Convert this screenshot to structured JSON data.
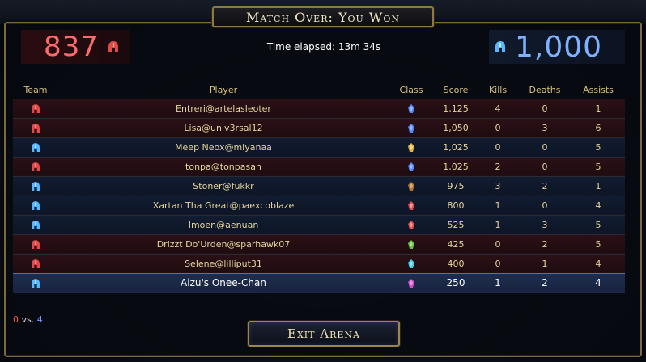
{
  "header": {
    "title": "Match Over: You Won"
  },
  "scores": {
    "red": {
      "value": "837",
      "color": "#ff6b6b"
    },
    "blue": {
      "value": "1,000",
      "color": "#7fb1ff"
    },
    "time_elapsed": "Time elapsed: 13m 34s"
  },
  "table": {
    "columns": [
      "Team",
      "Player",
      "Class",
      "Score",
      "Kills",
      "Deaths",
      "Assists"
    ],
    "rows": [
      {
        "team": "red",
        "player": "Entreri@artelasleoter",
        "class_icon": "blue-wizard-icon",
        "score": "1,125",
        "kills": "4",
        "deaths": "0",
        "assists": "1"
      },
      {
        "team": "red",
        "player": "Lisa@univ3rsal12",
        "class_icon": "blue-wizard-icon",
        "score": "1,050",
        "kills": "0",
        "deaths": "3",
        "assists": "6"
      },
      {
        "team": "blue",
        "player": "Meep Neox@miyanaa",
        "class_icon": "gold-shield-icon",
        "score": "1,025",
        "kills": "0",
        "deaths": "0",
        "assists": "5"
      },
      {
        "team": "red",
        "player": "tonpa@tonpasan",
        "class_icon": "blue-wizard-icon",
        "score": "1,025",
        "kills": "2",
        "deaths": "0",
        "assists": "5"
      },
      {
        "team": "blue",
        "player": "Stoner@fukkr",
        "class_icon": "bronze-chest-icon",
        "score": "975",
        "kills": "3",
        "deaths": "2",
        "assists": "1"
      },
      {
        "team": "blue",
        "player": "Xartan Tha Great@paexcoblaze",
        "class_icon": "red-blade-icon",
        "score": "800",
        "kills": "1",
        "deaths": "0",
        "assists": "4"
      },
      {
        "team": "blue",
        "player": "Imoen@aenuan",
        "class_icon": "red-blade-icon",
        "score": "525",
        "kills": "1",
        "deaths": "3",
        "assists": "5"
      },
      {
        "team": "red",
        "player": "Drizzt Do'Urden@sparhawk07",
        "class_icon": "green-arrow-icon",
        "score": "425",
        "kills": "0",
        "deaths": "2",
        "assists": "5"
      },
      {
        "team": "red",
        "player": "Selene@lilliput31",
        "class_icon": "cyan-crystal-icon",
        "score": "400",
        "kills": "0",
        "deaths": "1",
        "assists": "4"
      },
      {
        "team": "blue",
        "player": "Aizu's Onee-Chan",
        "class_icon": "pink-star-icon",
        "score": "250",
        "kills": "1",
        "deaths": "2",
        "assists": "4",
        "self": true
      }
    ]
  },
  "footer": {
    "red_count": "0",
    "vs": "vs.",
    "blue_count": "4"
  },
  "exit_button": {
    "label": "Exit Arena"
  },
  "colors": {
    "red_team": "#ff6b6b",
    "blue_team": "#7fb1ff",
    "gold_text": "#e8b84d",
    "frame": "#8c7a44"
  }
}
